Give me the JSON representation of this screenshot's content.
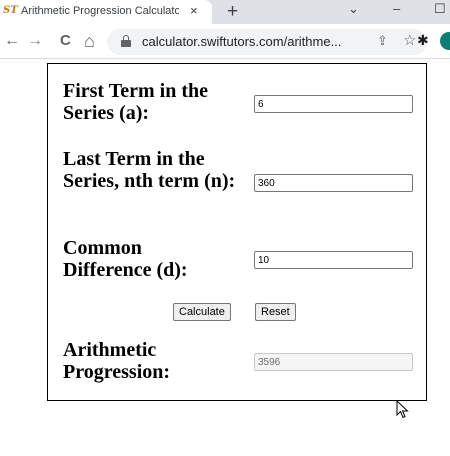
{
  "browser": {
    "tab_favicon": "ST",
    "tab_title": "Arithmetic Progression Calculato",
    "tab_close": "×",
    "new_tab": "+",
    "window_controls": [
      "⌄",
      "–",
      "☐"
    ],
    "nav": {
      "back": "←",
      "forward": "→",
      "reload": "C",
      "home": "⌂"
    },
    "url": "calculator.swiftutors.com/arithme...",
    "omnibox_icons": {
      "share": "⇪",
      "bookmark": "☆"
    },
    "extension_icon": "✱",
    "profile_color": "#0b7f76"
  },
  "calculator": {
    "first_term_label": "First Term in the Series (a):",
    "first_term_value": "6",
    "last_term_label": "Last Term in the Series, nth term (n):",
    "last_term_value": "360",
    "common_diff_label": "Common Difference (d):",
    "common_diff_value": "10",
    "calculate_label": "Calculate",
    "reset_label": "Reset",
    "result_label": "Arithmetic Progression:",
    "result_value": "3596"
  }
}
